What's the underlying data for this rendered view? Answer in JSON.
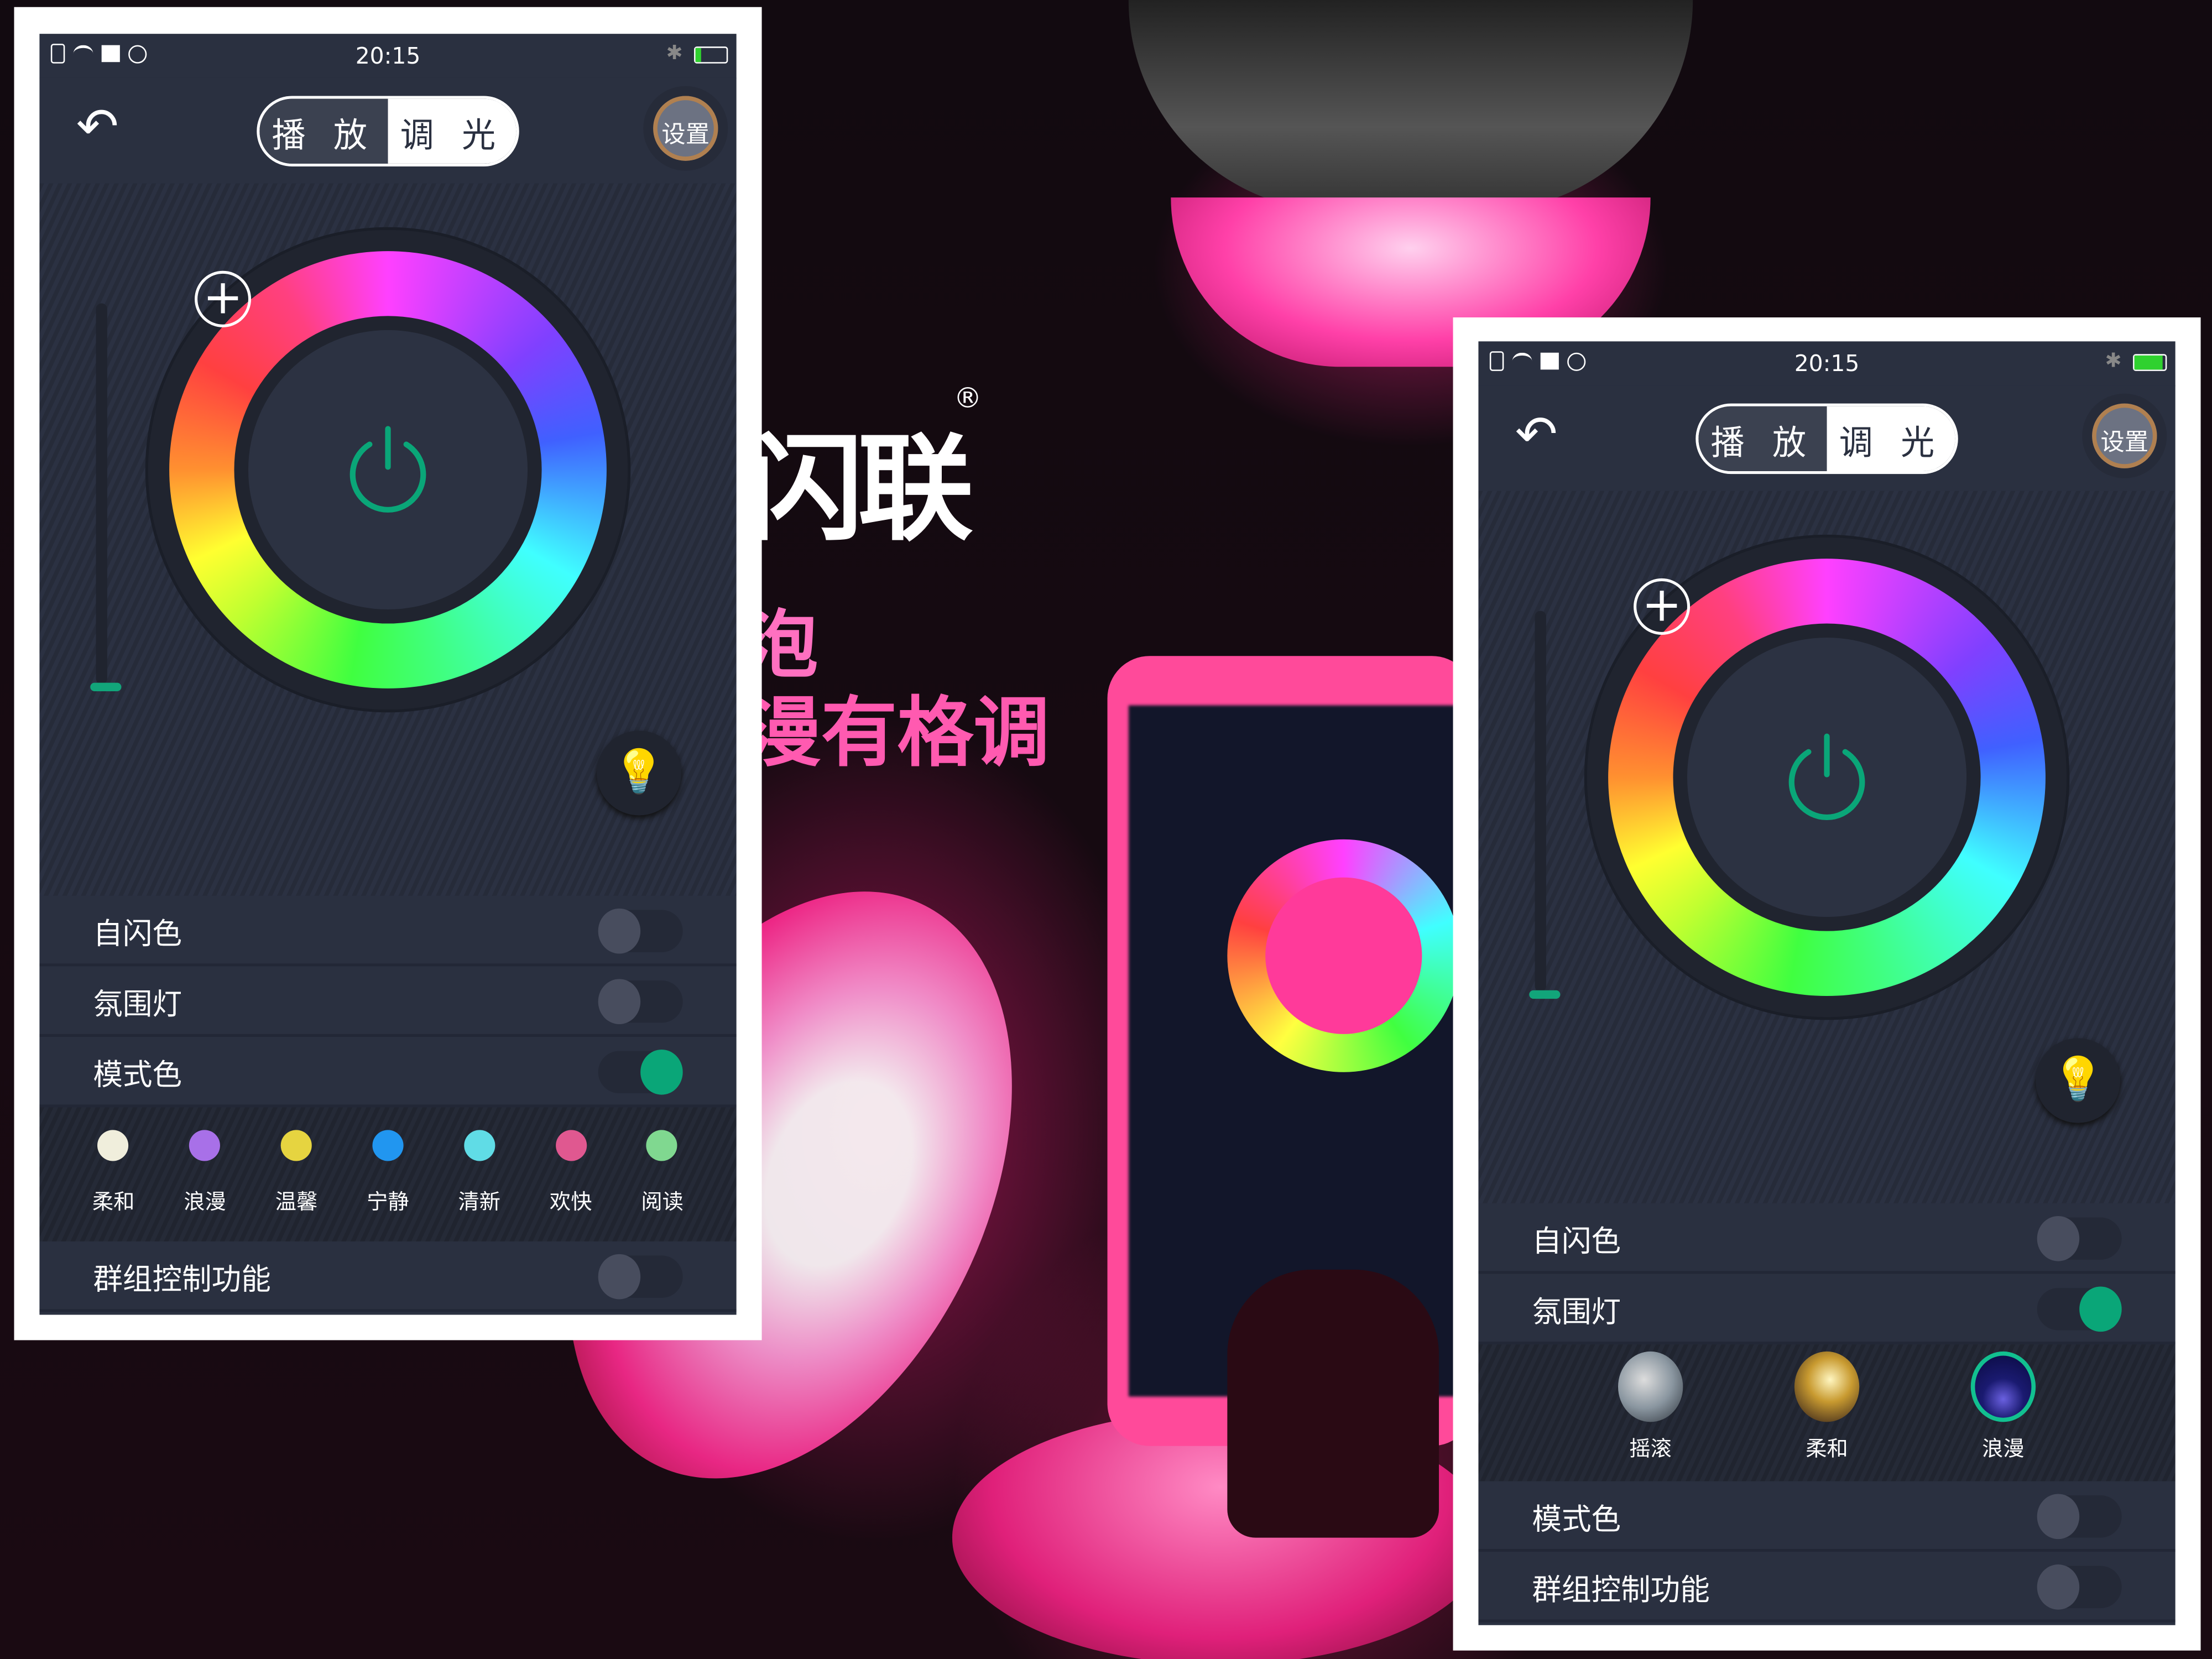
{
  "background": {
    "logo_text": "闪联",
    "registered_mark": "®",
    "tagline_1": "泡",
    "tagline_2": "漫有格调"
  },
  "colors": {
    "accent": "#0aa678",
    "panel": "#2a3040",
    "bulb_icon": "#e8a000",
    "battery": "#2fd12f"
  },
  "phones": [
    {
      "status": {
        "time": "20:15",
        "battery_level": 0.2
      },
      "header": {
        "back_icon": "back-arrow-icon",
        "tab_play": "播 放",
        "tab_dimming": "调 光",
        "active_tab": "调光",
        "settings_label": "设置"
      },
      "wheel": {
        "brightness_slider_value": 0,
        "power_icon": "power-icon",
        "add_icon": "plus-icon",
        "bulb_icon": "lightbulb-icon"
      },
      "rows": [
        {
          "type": "toggle",
          "label": "自闪色",
          "on": false
        },
        {
          "type": "toggle",
          "label": "氛围灯",
          "on": false
        },
        {
          "type": "toggle",
          "label": "模式色",
          "on": true
        },
        {
          "type": "swatches",
          "items": [
            {
              "label": "柔和",
              "color": "#f0eedc"
            },
            {
              "label": "浪漫",
              "color": "#a870e8"
            },
            {
              "label": "温馨",
              "color": "#e6d440"
            },
            {
              "label": "宁静",
              "color": "#2196f0"
            },
            {
              "label": "清新",
              "color": "#60dce6"
            },
            {
              "label": "欢快",
              "color": "#e05890"
            },
            {
              "label": "阅读",
              "color": "#80d890"
            }
          ]
        },
        {
          "type": "toggle",
          "label": "群组控制功能",
          "on": false
        }
      ]
    },
    {
      "status": {
        "time": "20:15",
        "battery_level": 0.9
      },
      "header": {
        "back_icon": "back-arrow-icon",
        "tab_play": "播 放",
        "tab_dimming": "调 光",
        "active_tab": "调光",
        "settings_label": "设置"
      },
      "wheel": {
        "brightness_slider_value": 0,
        "power_icon": "power-icon",
        "add_icon": "plus-icon",
        "bulb_icon": "lightbulb-icon"
      },
      "rows": [
        {
          "type": "toggle",
          "label": "自闪色",
          "on": false
        },
        {
          "type": "toggle",
          "label": "氛围灯",
          "on": true
        },
        {
          "type": "scenes",
          "items": [
            {
              "label": "摇滚",
              "selected": false,
              "thumb": "rock"
            },
            {
              "label": "柔和",
              "selected": false,
              "thumb": "soft"
            },
            {
              "label": "浪漫",
              "selected": true,
              "thumb": "romantic"
            }
          ]
        },
        {
          "type": "toggle",
          "label": "模式色",
          "on": false
        },
        {
          "type": "toggle",
          "label": "群组控制功能",
          "on": false
        }
      ]
    }
  ]
}
